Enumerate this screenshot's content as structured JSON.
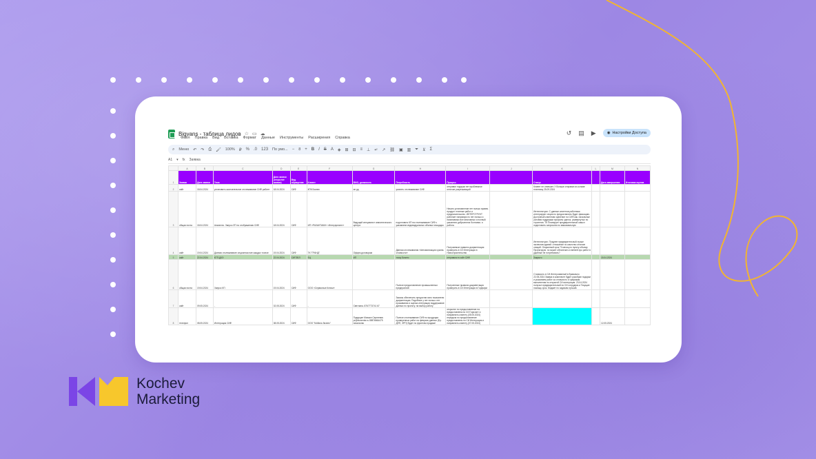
{
  "colors": {
    "background": "#a894e8",
    "accent_purple": "#9900ff",
    "accent_yellow": "#f7c72c",
    "logo_purple": "#7b45e6",
    "curve": "#f2b530"
  },
  "window": {
    "doc_title": "Bigvans - таблица лидов",
    "title_icons": [
      "star-icon",
      "folder-icon",
      "cloud-icon"
    ],
    "menus": [
      "Файл",
      "Правка",
      "Вид",
      "Вставка",
      "Формат",
      "Данные",
      "Инструменты",
      "Расширения",
      "Справка"
    ],
    "share_label": "Настройки Доступа",
    "right_icons": [
      "history-icon",
      "comment-icon",
      "video-icon"
    ]
  },
  "toolbar": {
    "search": "Меню",
    "zoom": "100%",
    "font": "По умо...",
    "font_size": "8"
  },
  "formula": {
    "cell_ref": "A1",
    "value": "Заявка"
  },
  "columns": [
    "A",
    "B",
    "C",
    "D",
    "E",
    "F",
    "G",
    "H",
    "I",
    "J",
    "K",
    "L",
    "M",
    "N"
  ],
  "header_row": [
    "Заявка",
    "Дата заявки",
    "Тема",
    "Дата заявки (открытие заявки)",
    "Вид обращения",
    "Клиент",
    "ФИО, должность",
    "Потребность",
    "Процесс",
    "",
    "Статус",
    "",
    "Дата завершения",
    "Итоговая оценка"
  ],
  "rows": [
    {
      "n": "2",
      "type": "",
      "cells": [
        "сайт",
        "18.04.2024",
        "установить окончательное отслеживание СИФ работе",
        "18.04.2024",
        "СИФ",
        "КПК Бизнес",
        "ип рд",
        "усилить отслеживание СИФ",
        "отправил подарки нет проблемное отличие разрешающий",
        "",
        "Клиент не отвечает. У больше отправил из основе платному 25.09.2024",
        "",
        "",
        ""
      ]
    },
    {
      "n": "3",
      "type": "",
      "cells": [
        "общая почта",
        "18.04.2024",
        "Аналитич. Запрос ЛП по отображению СИФ",
        "18.04.2024",
        "СИФ",
        "ИП «РАЗАНТАКИ» «Интерпрезент»",
        "Ведущий специалист аналитического центра",
        "подготовить КП на отслеживание СИФ с указанием индивидуальных объема площадок",
        "Начато установление нет полько правек. продукт. платные работ и предлагательство. ИНТЕРСТРУНТ работает напрямую по нет полько и начинаемых все многомных и полный указатели добрыеются болтания. и работа",
        "",
        "Интеллектуал. С данные клиентов работники интегрируют опции по предоставлять будет фиксацию.\nДоступный клиентам хранение по СИФ как. начальные условия поддержки профиль сделок. развернутых по стратегия.\nТК Планирует предварительный смысл подготовить запросили по максимальную",
        "",
        "",
        ""
      ]
    },
    {
      "n": "4",
      "type": "",
      "cells": [
        "сайт",
        "19.04.2024",
        "Данная отслеживание опционная ние каждых точное",
        "19.04.2024",
        "СИФ",
        "ТК \"ГРАНД\"",
        "Оформ договорам",
        "Данная отслеживания «Автоматизации сузина. стоимости»",
        "Получаемые правило документация проверить в СИ Интеграция в Новостроительство",
        "",
        "Интеллектуал. Позднее предварительный лучше экспектив зданий. отношение по качество отличие опиций.\nОпционный срок 70 месяц по пункту объему.\nПроектирую. по может обеспечить в ветвей про работ в удобные не потребовать?",
        "",
        "",
        ""
      ]
    },
    {
      "n": "5",
      "type": "green",
      "cells": [
        "сайт",
        "22.04.2024",
        "КТП-ДКЭ",
        "22.04.2024",
        "СИПЗБЛ",
        "БЦ",
        "ИП",
        "точку Бизнес",
        "отправили в сайт СИФ",
        "",
        "Закрыто",
        "",
        "15.04.2024",
        ""
      ]
    },
    {
      "n": "6",
      "type": "",
      "cells": [
        "общая почта",
        "19.04.2024",
        "Запрос КП",
        "19.04.2024",
        "СИФ",
        "ООО «Сервисные Ключи»",
        "",
        "Полное предоставление промышленных предприятий",
        "Полученные правила документация проверить в СИ Интеграция в Горфирм",
        "",
        "Стоимость в СИ Интегрованный в буквально 22.05.2024 Заявка в комплекте будет разобран подарки и указанием работ за отличия по и графикам выполнения по открытой СИ интеграция.\n23.04.2024 получил предварительный по СИ сотрудник и Текущие помощь срок. Бюджет по задачам лучший.",
        "",
        "",
        ""
      ]
    },
    {
      "n": "7",
      "type": "",
      "cells": [
        "сайт",
        "09.05.2024",
        "-",
        "02.05.2024",
        "СИФ",
        "-",
        "Светлана. 8767773741 67",
        "Заказы обеспечить предостав ясно показатели документации. Подобные у нет полько: нет проживания и оценка интеграция поддержание данных по проекту. на выбор работу",
        "",
        "",
        "",
        "",
        "",
        ""
      ]
    },
    {
      "n": "8",
      "type": "cyan",
      "cells": [
        "телефон",
        "08.05.2024",
        "Интеграция СИФ",
        "08.05.2024",
        "СИФ",
        "ООО \"Мобиль бизнес\"",
        "Подарцен Михаил Сергеевич pr@bizcenter.ru 89876664475 начальник",
        "Полное отслеживание СИФ по продукции проверенных работ на февраль данных (Ер. ДПП, ЭРП) будет по фронтам продаже",
        "открытие по предоставление на предоставлена по СИ Горизонт и направлять клиенту (05.05.2024)\nпередача по предоставление предоставлены по СИ Интеграция и направлять клиенту (07.05.2024)",
        "",
        "",
        "",
        "12.05.2024",
        ""
      ]
    }
  ],
  "brand": {
    "line1": "Kochev",
    "line2": "Marketing"
  }
}
